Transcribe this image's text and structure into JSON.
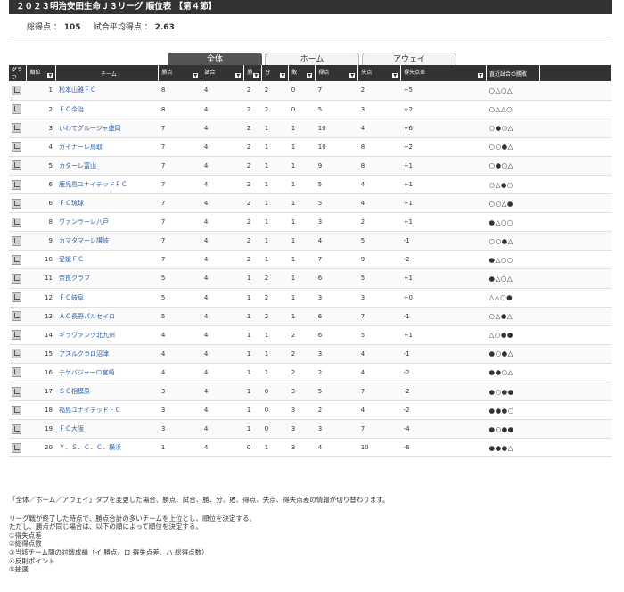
{
  "title": "２０２３明治安田生命Ｊ３リーグ 順位表 【第４節】",
  "summary": {
    "total_goals_label": "総得点 ：",
    "total_goals": "105",
    "avg_label": "試合平均得点 ：",
    "avg": "2.63"
  },
  "tabs": [
    "全体",
    "ホーム",
    "アウェイ"
  ],
  "headers": [
    "グラフ",
    "順位",
    "チーム",
    "勝点",
    "試合",
    "勝",
    "分",
    "敗",
    "得点",
    "失点",
    "得失点差",
    "直近試合の勝敗"
  ],
  "rows": [
    {
      "rank": "1",
      "team": "松本山雅ＦＣ",
      "pts": "8",
      "games": "4",
      "w": "2",
      "d": "2",
      "l": "0",
      "gf": "7",
      "ga": "2",
      "gd": "+5",
      "recent": "○△○△"
    },
    {
      "rank": "2",
      "team": "ＦＣ今治",
      "pts": "8",
      "games": "4",
      "w": "2",
      "d": "2",
      "l": "0",
      "gf": "5",
      "ga": "3",
      "gd": "+2",
      "recent": "○△△○"
    },
    {
      "rank": "3",
      "team": "いわてグルージャ盛岡",
      "pts": "7",
      "games": "4",
      "w": "2",
      "d": "1",
      "l": "1",
      "gf": "10",
      "ga": "4",
      "gd": "+6",
      "recent": "○●○△"
    },
    {
      "rank": "4",
      "team": "ガイナーレ鳥取",
      "pts": "7",
      "games": "4",
      "w": "2",
      "d": "1",
      "l": "1",
      "gf": "10",
      "ga": "8",
      "gd": "+2",
      "recent": "○○●△"
    },
    {
      "rank": "5",
      "team": "カターレ富山",
      "pts": "7",
      "games": "4",
      "w": "2",
      "d": "1",
      "l": "1",
      "gf": "9",
      "ga": "8",
      "gd": "+1",
      "recent": "○●○△"
    },
    {
      "rank": "6",
      "team": "鹿児島ユナイテッドＦＣ",
      "pts": "7",
      "games": "4",
      "w": "2",
      "d": "1",
      "l": "1",
      "gf": "5",
      "ga": "4",
      "gd": "+1",
      "recent": "○△●○"
    },
    {
      "rank": "6",
      "team": "ＦＣ琉球",
      "pts": "7",
      "games": "4",
      "w": "2",
      "d": "1",
      "l": "1",
      "gf": "5",
      "ga": "4",
      "gd": "+1",
      "recent": "○○△●"
    },
    {
      "rank": "8",
      "team": "ヴァンラーレ八戸",
      "pts": "7",
      "games": "4",
      "w": "2",
      "d": "1",
      "l": "1",
      "gf": "3",
      "ga": "2",
      "gd": "+1",
      "recent": "●△○○"
    },
    {
      "rank": "9",
      "team": "カマタマーレ讃岐",
      "pts": "7",
      "games": "4",
      "w": "2",
      "d": "1",
      "l": "1",
      "gf": "4",
      "ga": "5",
      "gd": "-1",
      "recent": "○○●△"
    },
    {
      "rank": "10",
      "team": "愛媛ＦＣ",
      "pts": "7",
      "games": "4",
      "w": "2",
      "d": "1",
      "l": "1",
      "gf": "7",
      "ga": "9",
      "gd": "-2",
      "recent": "●△○○"
    },
    {
      "rank": "11",
      "team": "奈良クラブ",
      "pts": "5",
      "games": "4",
      "w": "1",
      "d": "2",
      "l": "1",
      "gf": "6",
      "ga": "5",
      "gd": "+1",
      "recent": "●△○△"
    },
    {
      "rank": "12",
      "team": "ＦＣ岐阜",
      "pts": "5",
      "games": "4",
      "w": "1",
      "d": "2",
      "l": "1",
      "gf": "3",
      "ga": "3",
      "gd": "+0",
      "recent": "△△○●"
    },
    {
      "rank": "13",
      "team": "ＡＣ長野パルセイロ",
      "pts": "5",
      "games": "4",
      "w": "1",
      "d": "2",
      "l": "1",
      "gf": "6",
      "ga": "7",
      "gd": "-1",
      "recent": "○△●△"
    },
    {
      "rank": "14",
      "team": "ギラヴァンツ北九州",
      "pts": "4",
      "games": "4",
      "w": "1",
      "d": "1",
      "l": "2",
      "gf": "6",
      "ga": "5",
      "gd": "+1",
      "recent": "△○●●"
    },
    {
      "rank": "15",
      "team": "アスルクラロ沼津",
      "pts": "4",
      "games": "4",
      "w": "1",
      "d": "1",
      "l": "2",
      "gf": "3",
      "ga": "4",
      "gd": "-1",
      "recent": "●○●△"
    },
    {
      "rank": "16",
      "team": "テゲバジャーロ宮崎",
      "pts": "4",
      "games": "4",
      "w": "1",
      "d": "1",
      "l": "2",
      "gf": "2",
      "ga": "4",
      "gd": "-2",
      "recent": "●●○△"
    },
    {
      "rank": "17",
      "team": "ＳＣ相模原",
      "pts": "3",
      "games": "4",
      "w": "1",
      "d": "0",
      "l": "3",
      "gf": "5",
      "ga": "7",
      "gd": "-2",
      "recent": "●○●●"
    },
    {
      "rank": "18",
      "team": "福島ユナイテッドＦＣ",
      "pts": "3",
      "games": "4",
      "w": "1",
      "d": "0",
      "l": "3",
      "gf": "2",
      "ga": "4",
      "gd": "-2",
      "recent": "●●●○"
    },
    {
      "rank": "19",
      "team": "ＦＣ大阪",
      "pts": "3",
      "games": "4",
      "w": "1",
      "d": "0",
      "l": "3",
      "gf": "3",
      "ga": "7",
      "gd": "-4",
      "recent": "●○●●"
    },
    {
      "rank": "20",
      "team": "Ｙ．Ｓ．Ｃ．Ｃ．横浜",
      "pts": "1",
      "games": "4",
      "w": "0",
      "d": "1",
      "l": "3",
      "gf": "4",
      "ga": "10",
      "gd": "-6",
      "recent": "●●●△"
    }
  ],
  "notes": [
    "「全体／ホーム／アウェイ」タブを変更した場合、勝点、試合、勝、分、敗、得点、失点、得失点差の情報が切り替わります。",
    "リーグ戦が終了した時点で、勝点合計の多いチームを上位とし、順位を決定する。",
    "ただし、勝点が同じ場合は、以下の順によって順位を決定する。",
    "①得失点差",
    "②総得点数",
    "③当該チーム間の対戦成績（イ 勝点、ロ 得失点差、ハ 総得点数）",
    "④反則ポイント",
    "⑤抽選"
  ]
}
